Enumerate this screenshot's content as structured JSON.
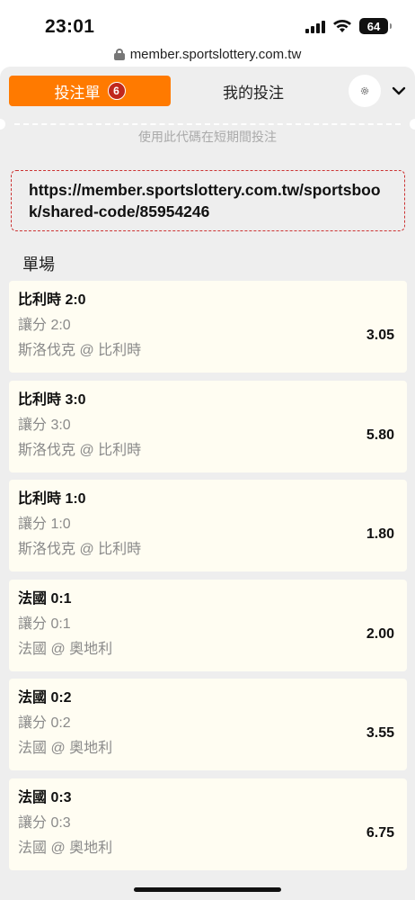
{
  "status_bar": {
    "time": "23:01",
    "battery": "64"
  },
  "browser": {
    "url": "member.sportslottery.com.tw"
  },
  "tabs": {
    "betslip_label": "投注單",
    "betslip_count": "6",
    "mybets_label": "我的投注"
  },
  "share": {
    "faded_hint": "使用此代碼在短期間投注",
    "url": "https://member.sportslottery.com.tw/sportsbook/shared-code/85954246"
  },
  "section_title": "單場",
  "bets": [
    {
      "selection": "比利時 2:0",
      "market": "讓分 2:0",
      "match": "斯洛伐克 @ 比利時",
      "odds": "3.05"
    },
    {
      "selection": "比利時 3:0",
      "market": "讓分 3:0",
      "match": "斯洛伐克 @ 比利時",
      "odds": "5.80"
    },
    {
      "selection": "比利時 1:0",
      "market": "讓分 1:0",
      "match": "斯洛伐克 @ 比利時",
      "odds": "1.80"
    },
    {
      "selection": "法國 0:1",
      "market": "讓分 0:1",
      "match": "法國 @ 奧地利",
      "odds": "2.00"
    },
    {
      "selection": "法國 0:2",
      "market": "讓分 0:2",
      "match": "法國 @ 奧地利",
      "odds": "3.55"
    },
    {
      "selection": "法國 0:3",
      "market": "讓分 0:3",
      "match": "法國 @ 奧地利",
      "odds": "6.75"
    }
  ],
  "colors": {
    "accent": "#ff7a00",
    "badge": "#c0271d",
    "card": "#fffdf2",
    "panel": "#eeeeee",
    "share_border": "#cc3333"
  },
  "icons": [
    "lock-icon",
    "settings-icon",
    "chevron-down-icon",
    "wifi-icon",
    "signal-icon",
    "battery-icon"
  ]
}
